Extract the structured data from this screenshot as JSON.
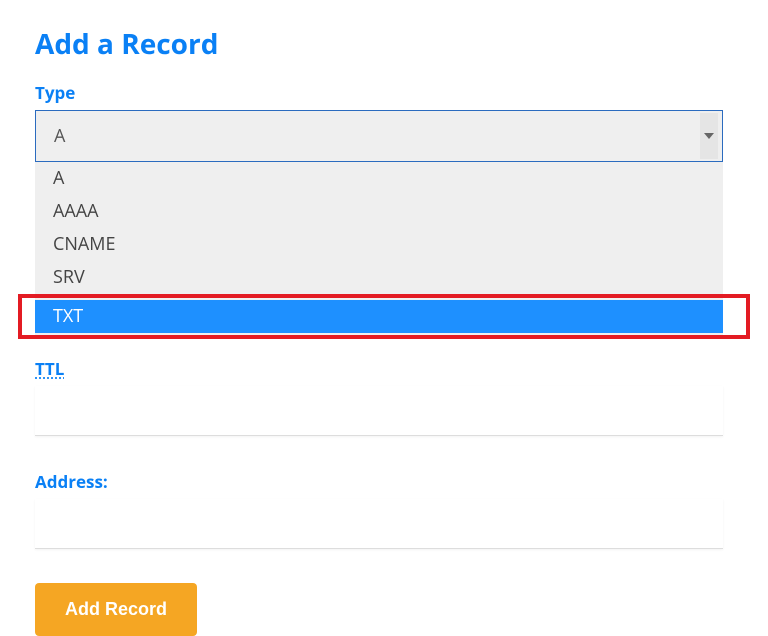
{
  "heading": "Add a Record",
  "type": {
    "label": "Type",
    "selected": "A",
    "options": [
      "A",
      "AAAA",
      "CNAME",
      "SRV",
      "TXT"
    ],
    "highlighted_option": "TXT"
  },
  "ttl": {
    "label": "TTL",
    "value": ""
  },
  "address": {
    "label": "Address:",
    "value": ""
  },
  "submit": {
    "label": "Add Record"
  },
  "highlight_color": "#e31b23",
  "accent_color": "#0a80f5",
  "button_color": "#f5a623"
}
